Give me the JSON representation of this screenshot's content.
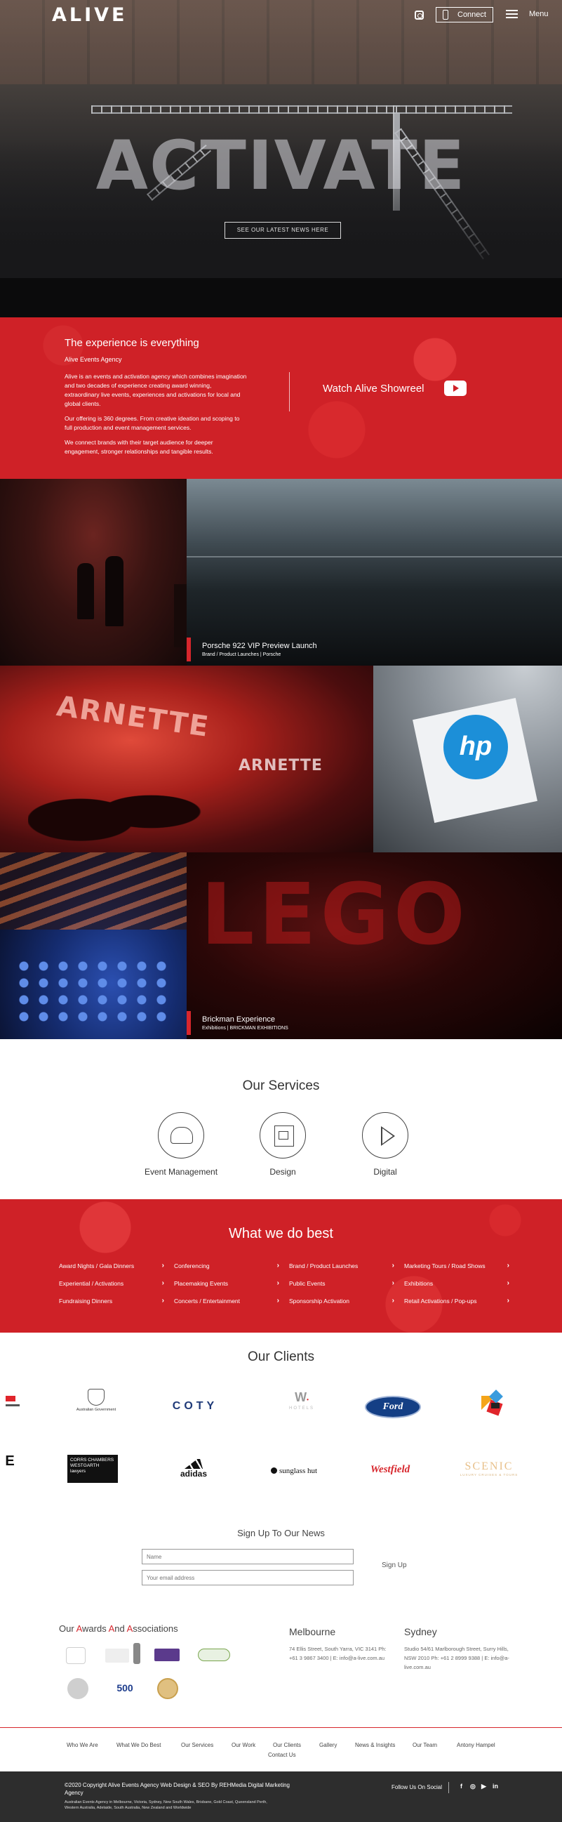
{
  "header": {
    "logo": "ALIVE",
    "connect_label": "Connect",
    "menu_label": "Menu"
  },
  "hero": {
    "headline": "ACTIVATE",
    "news_button": "SEE OUR LATEST NEWS HERE"
  },
  "intro": {
    "title": "The experience is everything",
    "subtitle": "Alive Events Agency",
    "para1": "Alive is an events and activation agency which combines imagination and two decades of experience creating award winning, extraordinary live events, experiences and activations for local and global clients.",
    "para2": "Our offering is 360 degrees. From creative ideation and scoping to full production and event management services.",
    "para3": "We connect brands with their target audience for deeper engagement, stronger relationships and tangible results.",
    "showreel_label": "Watch Alive Showreel"
  },
  "gallery": {
    "porsche_title": "Porsche 922 VIP Preview Launch",
    "porsche_sub": "Brand / Product Launches  |  Porsche",
    "arnette_sign_1": "ARNETTE",
    "arnette_sign_2": "ARNETTE",
    "hp_logo": "hp",
    "lego_text": "LEGO",
    "brickman_title": "Brickman Experience",
    "brickman_sub": "Exhibitions  |  BRICKMAN EXHIBITIONS"
  },
  "services": {
    "title": "Our Services",
    "items": [
      {
        "label": "Event Management"
      },
      {
        "label": "Design"
      },
      {
        "label": "Digital"
      }
    ]
  },
  "best": {
    "title": "What we do best",
    "items": [
      "Award Nights / Gala Dinners",
      "Conferencing",
      "Brand / Product Launches",
      "Marketing Tours / Road Shows",
      "Experiential / Activations",
      "Placemaking Events",
      "Public Events",
      "Exhibitions",
      "Fundraising Dinners",
      "Concerts / Entertainment",
      "Sponsorship Activation",
      "Retail Activations / Pop-ups"
    ],
    "chevron": "›"
  },
  "clients": {
    "title": "Our Clients",
    "row1": [
      "Australian Government",
      "COTY",
      "W HOTELS",
      "Ford"
    ],
    "row2": [
      "CORRS CHAMBERS WESTGARTH lawyers",
      "adidas",
      "sunglass hut",
      "Westfield",
      "SCENIC"
    ],
    "w_hotels_sub": "HOTELS",
    "scenic_sub": "LUXURY CRUISES & TOURS"
  },
  "newsletter": {
    "title": "Sign Up To Our News",
    "name_placeholder": "Name",
    "email_placeholder": "Your email address",
    "signup_label": "Sign Up"
  },
  "awards": {
    "title_parts": [
      "Our ",
      "A",
      "wards ",
      "A",
      "nd ",
      "A",
      "ssociations"
    ],
    "badge_500": "500"
  },
  "offices": {
    "melbourne": {
      "name": "Melbourne",
      "address": "74 Ellis Street, South Yarra, VIC 3141 Ph: +61 3 9867 3400 | E: info@a-live.com.au"
    },
    "sydney": {
      "name": "Sydney",
      "address": "Studio 54/61 Marlborough Street, Surry Hills, NSW 2010 Ph: +61 2 8999 9388 | E: info@a-live.com.au"
    }
  },
  "footer_nav": [
    "Who We Are",
    "What We Do Best",
    "Our Services",
    "Our Work",
    "Our Clients",
    "Gallery",
    "News & Insights",
    "Our Team",
    "Antony Hampel",
    "Contact Us"
  ],
  "footer": {
    "copyright": "©2020 Copyright Alive Events Agency Web Design & SEO By REHMedia Digital Marketing Agency",
    "small": "Australian Events Agency in Melbourne, Victoria, Sydney, New South Wales, Brisbane, Gold Coast, Queensland Perth, Western Australia, Adelaide, South Australia, New Zealand and Worldwide",
    "follow": "Follow Us On Social",
    "social": [
      "f",
      "◎",
      "▶",
      "in"
    ]
  },
  "colors": {
    "brand_red": "#cf2127",
    "accent_red": "#d7262c",
    "footer_dark": "#2d2d2d"
  }
}
